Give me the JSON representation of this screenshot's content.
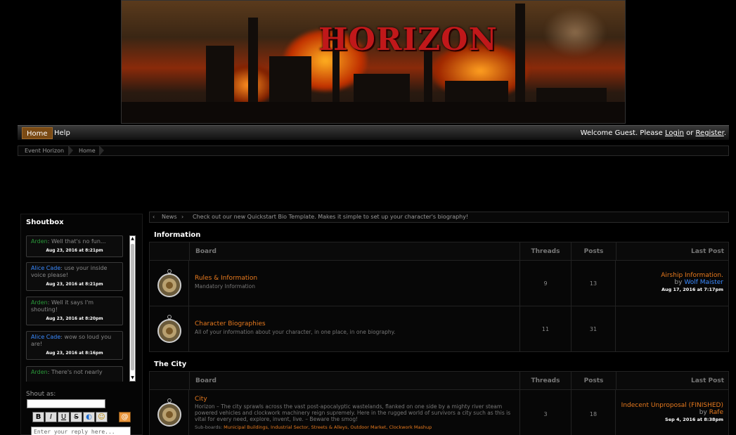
{
  "banner": {
    "logo_text": "HORIZON"
  },
  "nav": {
    "items": [
      {
        "label": "Home"
      },
      {
        "label": "Help"
      }
    ],
    "welcome_prefix": "Welcome Guest. Please",
    "login": "Login",
    "or": "or",
    "register": "Register",
    "period": "."
  },
  "breadcrumb": [
    "Event Horizon",
    "Home"
  ],
  "news": {
    "left_arrow": "‹",
    "label": "News",
    "right_arrow": "›",
    "text": "Check out our new Quickstart Bio Template. Makes it simple to set up your character's biography!"
  },
  "shoutbox": {
    "title": "Shoutbox",
    "shouts": [
      {
        "author": "Arden",
        "text": ": Well that's no fun...",
        "time": "Aug 23, 2016 at 8:21pm"
      },
      {
        "author": "Alice Cade",
        "text": ": use your inside voice please!",
        "time": "Aug 23, 2016 at 8:21pm"
      },
      {
        "author": "Arden",
        "text": ": Well it says I'm shouting!",
        "time": "Aug 23, 2016 at 8:20pm"
      },
      {
        "author": "Alice Cade",
        "text": ": wow so loud you are!",
        "time": "Aug 23, 2016 at 8:16pm"
      },
      {
        "author": "Arden",
        "text": ": There's not nearly",
        "time": ""
      }
    ],
    "shout_as_label": "Shout as:",
    "format_buttons": [
      "B",
      "I",
      "U",
      "S",
      "◐",
      "☺"
    ],
    "at_button": "@",
    "reply_placeholder": "Enter your reply here..."
  },
  "categories": [
    {
      "title": "Information",
      "headers": {
        "board": "Board",
        "threads": "Threads",
        "posts": "Posts",
        "last_post": "Last Post"
      },
      "boards": [
        {
          "name": "Rules & Information",
          "description": "Mandatory Information",
          "threads": "9",
          "posts": "13",
          "last_post": {
            "title": "Airship Information.",
            "by": "by",
            "user": "Wolf Maister",
            "date": "Aug 17, 2016 at 7:17pm"
          }
        },
        {
          "name": "Character Biographies",
          "description": "All of your information about your character, in one place, in one biography.",
          "threads": "11",
          "posts": "31",
          "last_post": null
        }
      ]
    },
    {
      "title": "The City",
      "headers": {
        "board": "Board",
        "threads": "Threads",
        "posts": "Posts",
        "last_post": "Last Post"
      },
      "boards": [
        {
          "name": "City",
          "description": "Horizon – The city sprawls across the vast post-apocalyptic wastelands, flanked on one side by a mighty river steam powered vehicles and clockwork machinery reign supremely. Here in the rugged world of survivors a city such as this is vital for every need, explore, invent, live. – Beware the smog!",
          "sub_label": "Sub-boards:",
          "sub_boards": "Municipal Buildings, Industrial Sector, Streets & Alleys, Outdoor Market, Clockwork Mashup",
          "threads": "3",
          "posts": "18",
          "last_post": {
            "title": "Indecent Unproposal (FINISHED)",
            "by": "by",
            "user": "Rafe",
            "date": "Sep 4, 2016 at 8:38pm"
          }
        }
      ]
    }
  ]
}
